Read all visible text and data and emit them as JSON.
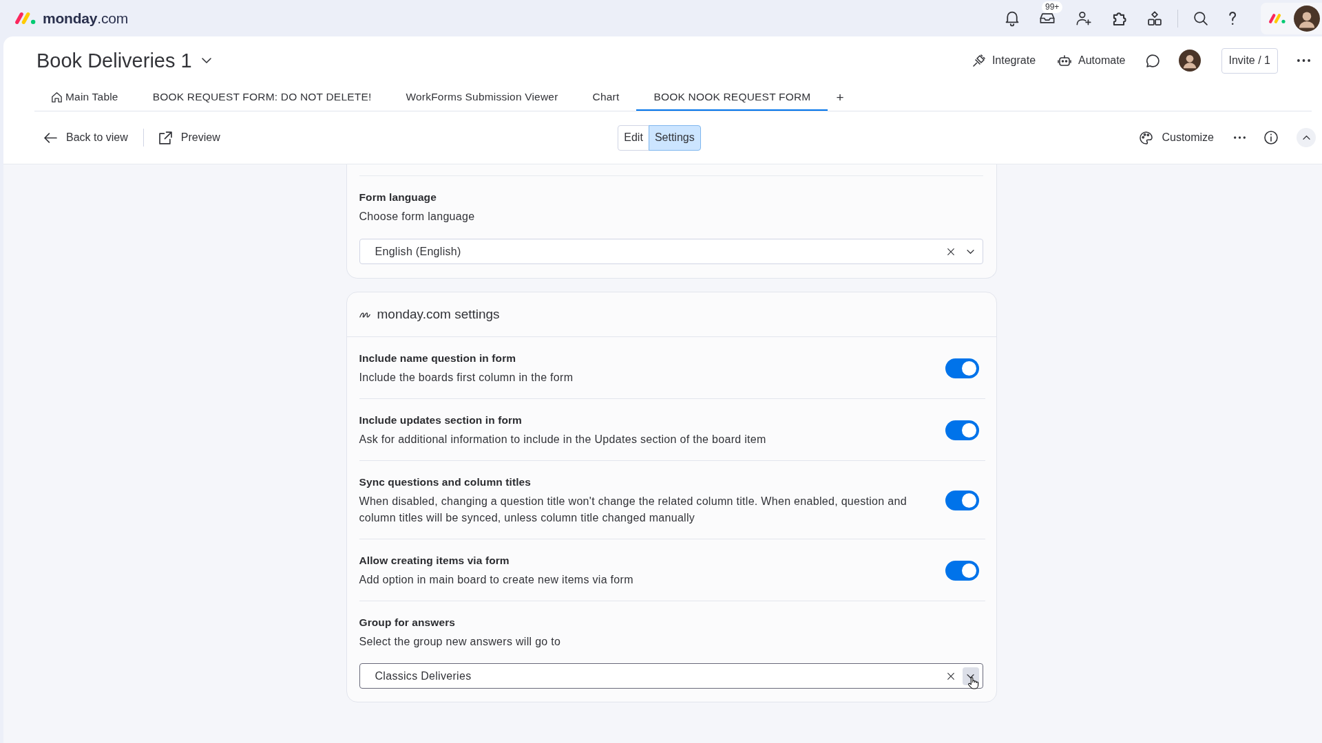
{
  "top_bar": {
    "logo": "**monday**.com",
    "inbox_badge": "99+"
  },
  "board": {
    "title": "Book Deliveries 1",
    "actions": [
      {
        "kind": "integrate",
        "label": "Integrate"
      },
      {
        "kind": "automate",
        "label": "Automate"
      }
    ],
    "invite": "Invite / 1"
  },
  "tabs": [
    {
      "kind": "home",
      "label": "Main Table",
      "selected": false
    },
    {
      "kind": "view",
      "label": "BOOK REQUEST FORM: DO NOT DELETE!",
      "selected": false
    },
    {
      "kind": "view",
      "label": "WorkForms Submission Viewer",
      "selected": false
    },
    {
      "kind": "view",
      "label": "Chart",
      "selected": false
    },
    {
      "kind": "view",
      "label": "BOOK NOOK REQUEST FORM",
      "selected": true
    }
  ],
  "add_tab": "+",
  "toolbar": {
    "back": "Back to view",
    "preview": "Preview",
    "modes": [
      {
        "label": "Edit",
        "selected": false
      },
      {
        "label": "Settings",
        "selected": true
      }
    ],
    "customize": "Customize"
  },
  "form_language": {
    "title": "Form language",
    "description": "Choose form language",
    "value": "English (English)",
    "hovered": false
  },
  "monday_settings": {
    "title": "monday.com settings",
    "rows": [
      {
        "kind": "toggle",
        "title": "Include name question in form",
        "description": "Include the boards first column in the form",
        "on": true
      },
      {
        "kind": "toggle",
        "title": "Include updates section in form",
        "description": "Ask for additional information to include in the Updates section of the board item",
        "on": true
      },
      {
        "kind": "toggle",
        "title": "Sync questions and column titles",
        "description": "When disabled, changing a question title won't change the related column title. When enabled, question and column titles will be synced, unless column title changed manually",
        "on": true
      },
      {
        "kind": "toggle",
        "title": "Allow creating items via form",
        "description": "Add option in main board to create new items via form",
        "on": true
      },
      {
        "kind": "select",
        "title": "Group for answers",
        "description": "Select the group new answers will go to",
        "value": "Classics Deliveries",
        "hovered": true
      }
    ]
  }
}
